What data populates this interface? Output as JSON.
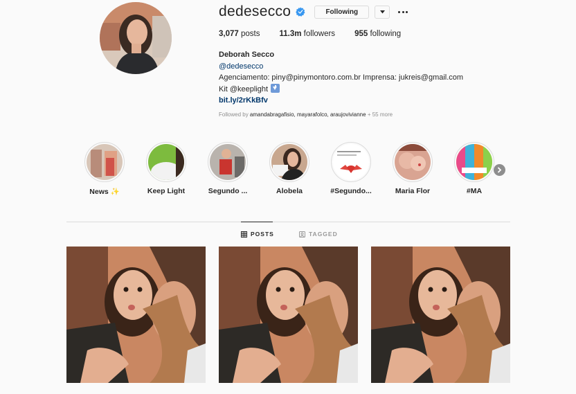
{
  "profile": {
    "username": "dedesecco",
    "verified": true,
    "follow_button": "Following",
    "stats": {
      "posts_count": "3,077",
      "posts_label": "posts",
      "followers_count": "11.3m",
      "followers_label": "followers",
      "following_count": "955",
      "following_label": "following"
    },
    "bio": {
      "name": "Deborah Secco",
      "handle": "@dedesecco",
      "line1": "Agenciamento: piny@pinymontoro.com.br Imprensa: jukreis@gmail.com",
      "line2_prefix": "Kit @keeplight",
      "line2_icon": "down-arrow-emoji",
      "link": "bit.ly/2rKkBfv"
    },
    "followed_by": {
      "prefix": "Followed by",
      "names": "amandabragafisio, mayarafolco, araujovivianne",
      "suffix": "+ 55 more"
    }
  },
  "highlights": [
    {
      "label": "News ✨"
    },
    {
      "label": "Keep Light"
    },
    {
      "label": "Segundo ..."
    },
    {
      "label": "Alobela"
    },
    {
      "label": "#Segundo..."
    },
    {
      "label": "Maria Flor"
    },
    {
      "label": "#MA"
    }
  ],
  "tabs": {
    "posts": "POSTS",
    "tagged": "TAGGED"
  },
  "colors": {
    "background": "#fafafa",
    "text": "#262626",
    "secondary": "#8e8e8e",
    "link": "#00376b",
    "verified": "#3897f0",
    "border": "#dbdbdb"
  }
}
